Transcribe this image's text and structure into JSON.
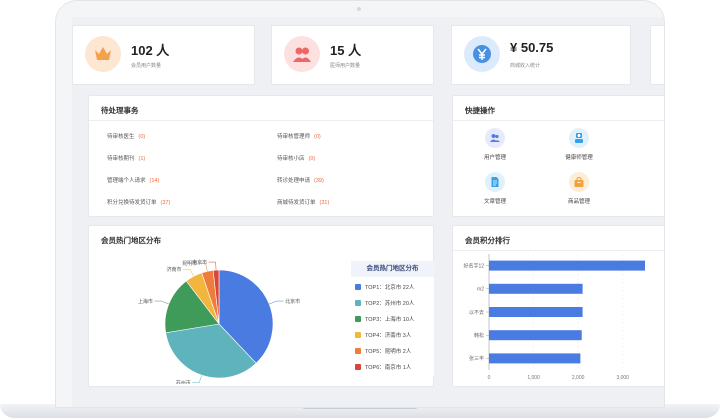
{
  "stats": [
    {
      "value": "102 人",
      "label": "会员用户数量",
      "icon": "crown-icon",
      "color": "#f4a14b",
      "bg": "#fde7d3"
    },
    {
      "value": "15 人",
      "label": "医师用户数量",
      "icon": "users-icon",
      "color": "#ee6666",
      "bg": "#fde0e0"
    },
    {
      "value": "¥ 50.75",
      "label": "商城收入统计",
      "icon": "yen-icon",
      "color": "#4a90e2",
      "bg": "#dcebfb"
    }
  ],
  "todo": {
    "title": "待处理事务",
    "items": [
      {
        "label": "待审核医生",
        "count": "(0)"
      },
      {
        "label": "待审核管理师",
        "count": "(0)"
      },
      {
        "label": "待审核期刊",
        "count": "(1)"
      },
      {
        "label": "待审核小店",
        "count": "(0)"
      },
      {
        "label": "管理端个人请求",
        "count": "(14)"
      },
      {
        "label": "转诊处理申请",
        "count": "(39)"
      },
      {
        "label": "积分兑换待发货订单",
        "count": "(37)"
      },
      {
        "label": "商城待发货订单",
        "count": "(31)"
      }
    ]
  },
  "quick": {
    "title": "快捷操作",
    "items": [
      {
        "label": "用户管理",
        "icon": "user-group-icon"
      },
      {
        "label": "健康师管理",
        "icon": "health-manager-icon"
      },
      {
        "label": "文章管理",
        "icon": "document-icon"
      },
      {
        "label": "商品管理",
        "icon": "product-box-icon"
      }
    ]
  },
  "region": {
    "title": "会员热门地区分布",
    "legend_title": "会员热门地区分布"
  },
  "ranking": {
    "title": "会员积分排行"
  },
  "chart_data": [
    {
      "type": "pie",
      "title": "会员热门地区分布",
      "categories": [
        "北京市",
        "苏州市",
        "上海市",
        "济南市",
        "昆明市",
        "南京市"
      ],
      "values": [
        22,
        20,
        10,
        3,
        2,
        1
      ],
      "legend_labels": [
        "TOP1：北京市 22人",
        "TOP2：苏州市 20人",
        "TOP3：上海市 10人",
        "TOP4：济南市 3人",
        "TOP5：昆明市 2人",
        "TOP6：南京市 1人"
      ],
      "colors": [
        "#4a7be0",
        "#5fb3bd",
        "#3f9b5a",
        "#f2b63e",
        "#ee7d3a",
        "#d9463a"
      ],
      "legend": "right"
    },
    {
      "type": "bar",
      "orientation": "horizontal",
      "title": "会员积分排行",
      "categories": [
        "好名字12",
        "m2",
        "以不去",
        "韩松",
        "张三丰"
      ],
      "values": [
        3500,
        2100,
        2100,
        2080,
        2050
      ],
      "xlim": [
        0,
        3500
      ],
      "xticks": [
        "0",
        "1,000",
        "2,000",
        "3,000"
      ],
      "color": "#4a7be0"
    }
  ]
}
